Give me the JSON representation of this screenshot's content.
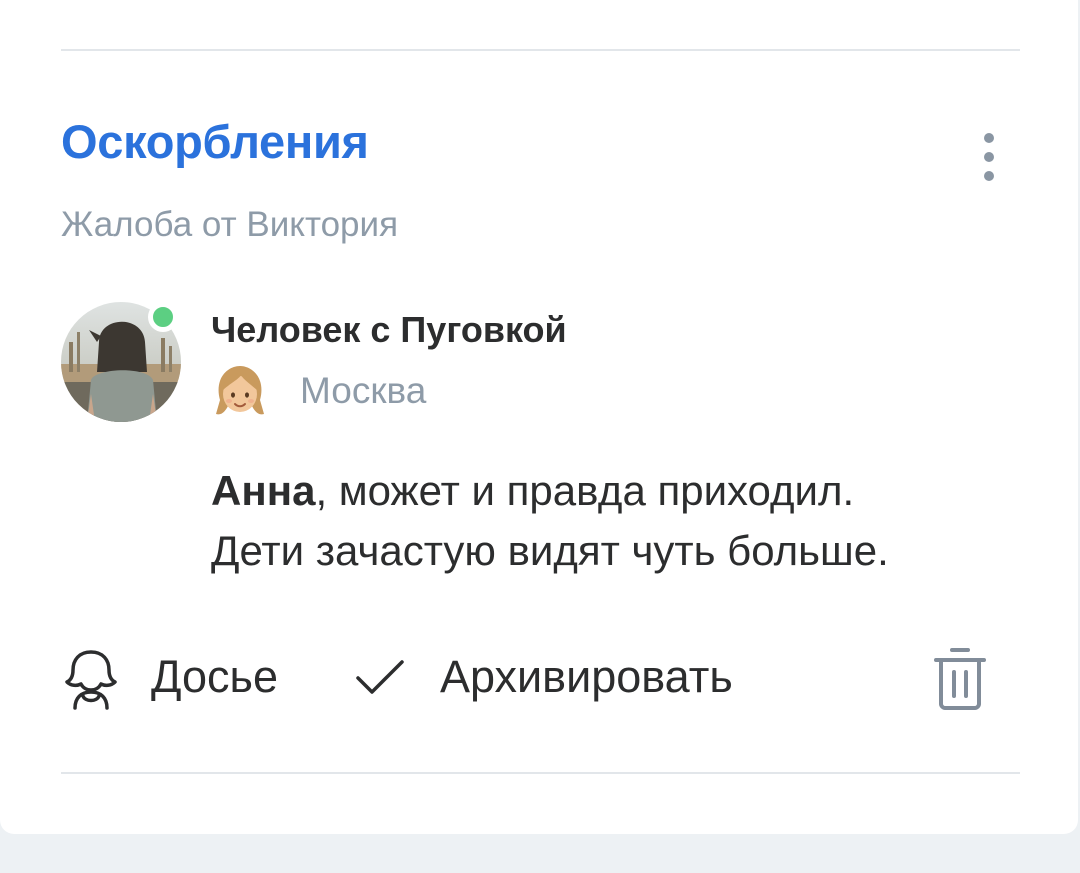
{
  "report": {
    "category": "Оскорбления",
    "complaint_prefix": "Жалоба от ",
    "complaint_author": "Виктория",
    "more_icon": "more-vertical-icon"
  },
  "comment_author": {
    "name": "Человек с Пуговкой",
    "city": "Москва",
    "online": true,
    "online_color": "#5ccf82",
    "emoji_icon": "girl-emoji-icon"
  },
  "comment": {
    "mention": "Анна",
    "line1_rest": ", может и правда приходил.",
    "line2": "Дети зачастую видят чуть больше."
  },
  "actions": {
    "dossier_label": "Досье",
    "dossier_icon": "user-outline-icon",
    "archive_label": "Архивировать",
    "archive_icon": "check-icon",
    "delete_icon": "trash-icon"
  },
  "colors": {
    "accent": "#2b72dc",
    "secondary_text": "#8e9ba8",
    "primary_text": "#2c2d2e",
    "icon": "#818c99"
  }
}
